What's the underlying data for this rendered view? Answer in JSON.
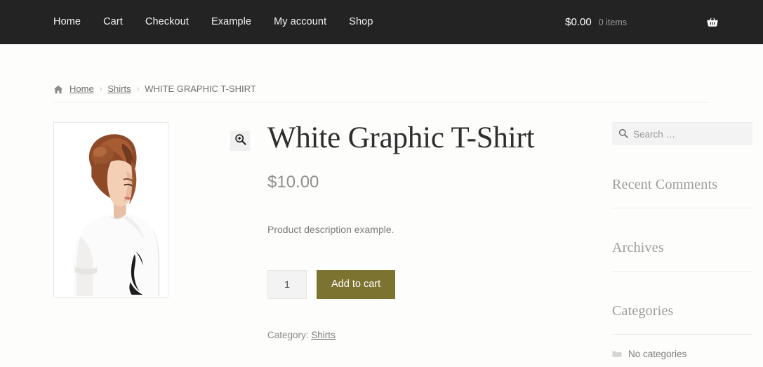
{
  "header": {
    "nav": [
      {
        "label": "Home"
      },
      {
        "label": "Cart"
      },
      {
        "label": "Checkout"
      },
      {
        "label": "Example"
      },
      {
        "label": "My account"
      },
      {
        "label": "Shop"
      }
    ],
    "cart": {
      "total": "$0.00",
      "count": "0 items",
      "icon": "shopping-basket-icon"
    },
    "background_color": "#232323"
  },
  "breadcrumb": {
    "home_icon": "home-icon",
    "items": [
      {
        "label": "Home",
        "type": "link"
      },
      {
        "label": "Shirts",
        "type": "link"
      },
      {
        "label": "WHITE GRAPHIC T-SHIRT",
        "type": "current"
      }
    ],
    "separator": "›"
  },
  "gallery": {
    "zoom_icon": "magnifier-plus-icon",
    "image_alt": "White Graphic T-Shirt product photo"
  },
  "product": {
    "title": "White Graphic T-Shirt",
    "price": "$10.00",
    "description": "Product description example.",
    "quantity": "1",
    "quantity_placeholder": "1",
    "add_to_cart_label": "Add to cart",
    "add_to_cart_color": "#7d7331",
    "meta_label": "Category:",
    "meta_value": "Shirts"
  },
  "sidebar": {
    "search": {
      "placeholder": "Search …",
      "value": "",
      "icon": "search-icon"
    },
    "widgets": [
      {
        "title": "Recent Comments",
        "items": []
      },
      {
        "title": "Archives",
        "items": []
      },
      {
        "title": "Categories",
        "items": [
          {
            "label": "No categories",
            "icon": "folder-icon"
          }
        ]
      }
    ]
  }
}
